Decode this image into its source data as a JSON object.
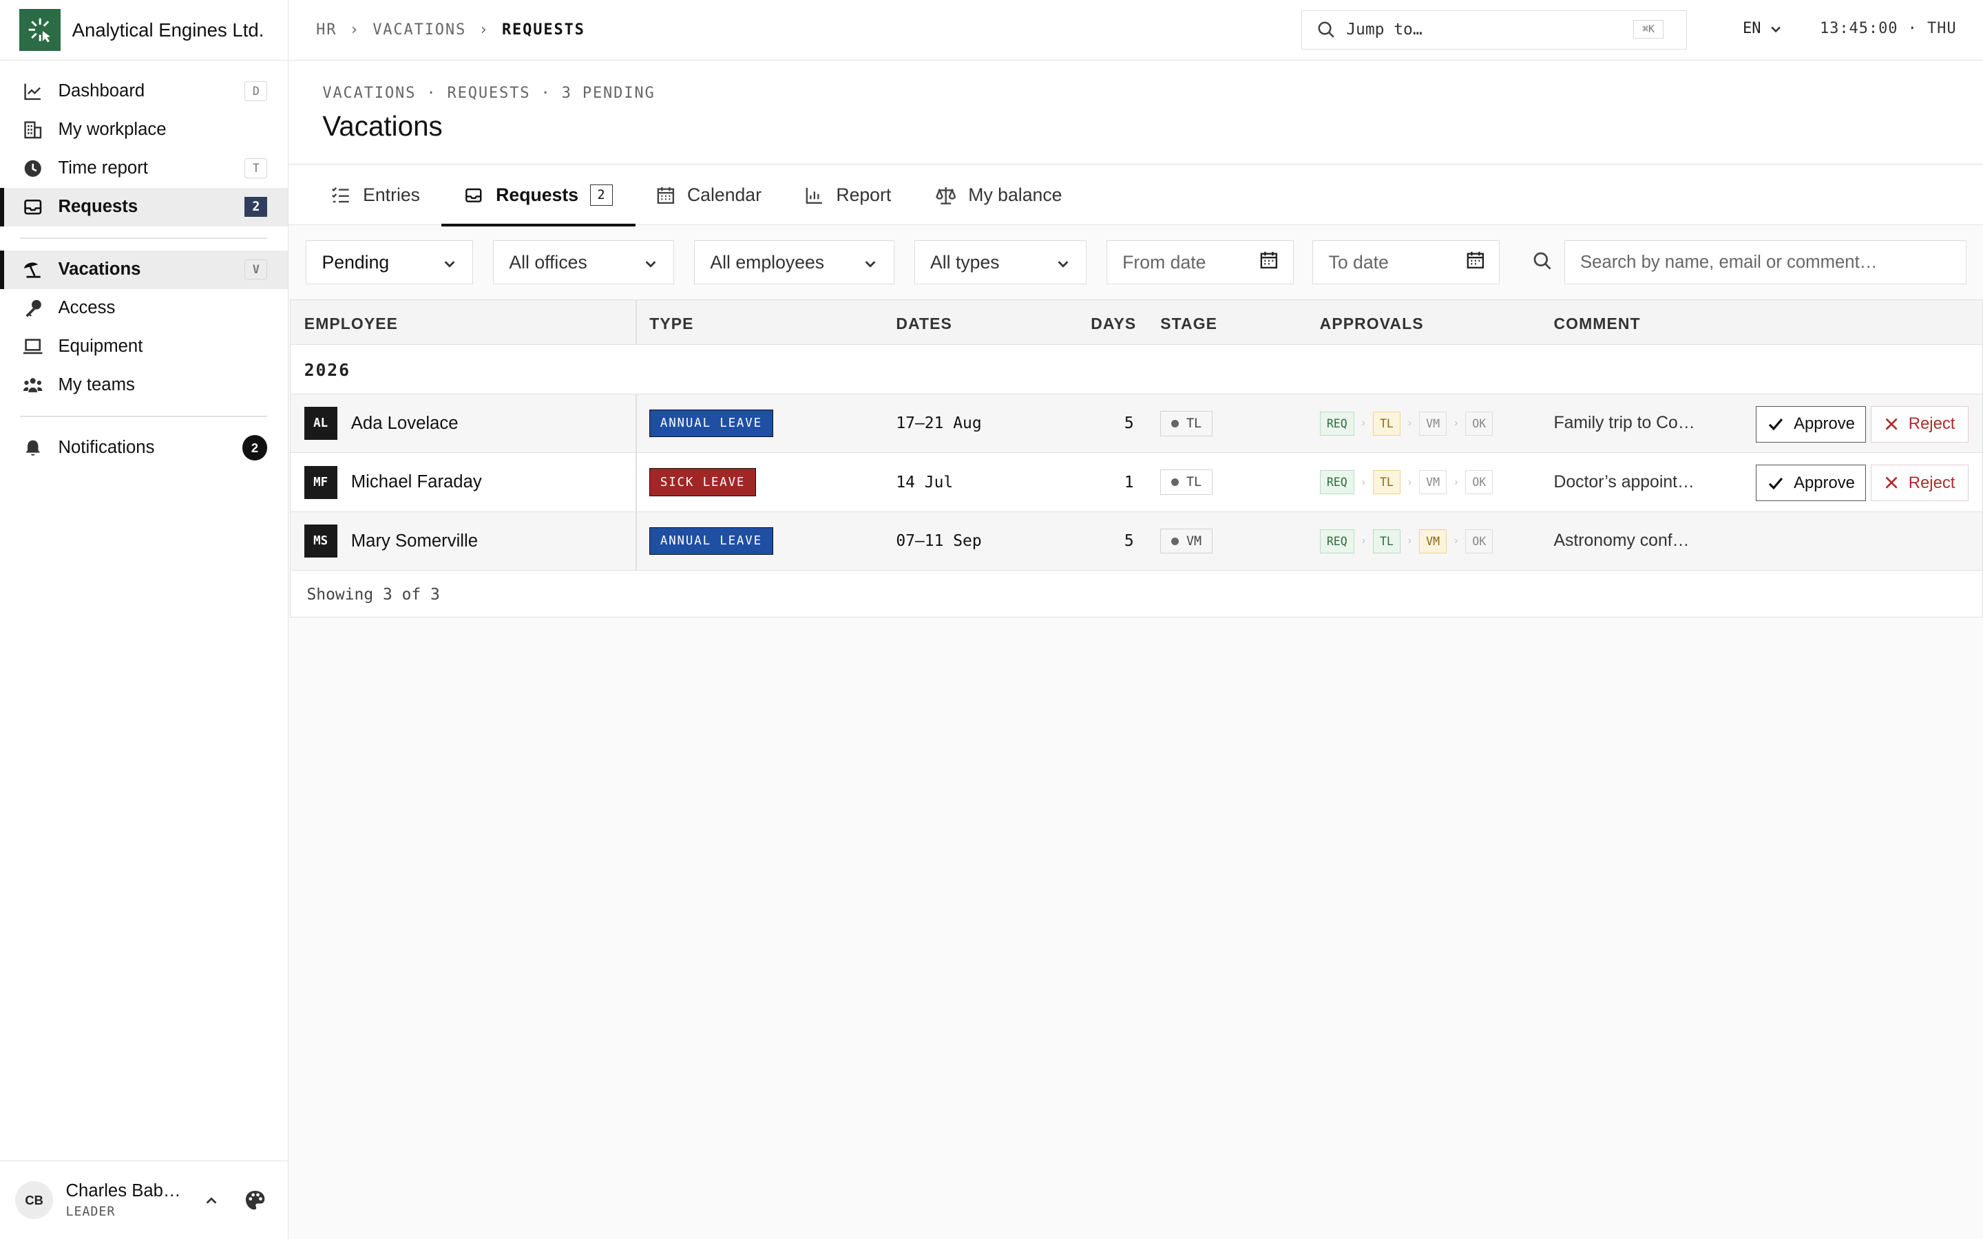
{
  "app": {
    "name": "Analytical Engines Ltd."
  },
  "sidebar": {
    "items": [
      {
        "label": "Dashboard",
        "icon": "chart-line-icon",
        "key": "D"
      },
      {
        "label": "My workplace",
        "icon": "building-icon"
      },
      {
        "label": "Time report",
        "icon": "clock-icon",
        "key": "T"
      },
      {
        "label": "Requests",
        "icon": "inbox-icon",
        "count": "2",
        "active": true
      },
      {
        "label": "Vacations",
        "icon": "beach-umbrella-icon",
        "key": "V",
        "active": true
      },
      {
        "label": "Access",
        "icon": "key-icon"
      },
      {
        "label": "Equipment",
        "icon": "laptop-icon"
      },
      {
        "label": "My teams",
        "icon": "users-icon"
      },
      {
        "label": "Notifications",
        "icon": "bell-icon",
        "count": "2"
      }
    ],
    "user": {
      "initials": "CB",
      "name": "Charles Bab…",
      "role": "LEADER"
    }
  },
  "topbar": {
    "breadcrumb": [
      "HR",
      "VACATIONS",
      "REQUESTS"
    ],
    "jump_placeholder": "Jump to…",
    "jump_shortcut": "⌘K",
    "language": "EN",
    "clock": "13:45:00 · THU"
  },
  "header": {
    "subtitle": "VACATIONS · REQUESTS · 3 PENDING",
    "title": "Vacations"
  },
  "tabs": [
    {
      "label": "Entries",
      "icon": "list-icon"
    },
    {
      "label": "Requests",
      "icon": "inbox-icon",
      "count": "2",
      "active": true
    },
    {
      "label": "Calendar",
      "icon": "calendar-icon"
    },
    {
      "label": "Report",
      "icon": "bar-chart-icon"
    },
    {
      "label": "My balance",
      "icon": "scale-icon"
    }
  ],
  "filters": {
    "status": "Pending",
    "office": "All offices",
    "employee": "All employees",
    "type": "All types",
    "from_date": "From date",
    "to_date": "To date",
    "search_placeholder": "Search by name, email or comment…"
  },
  "table": {
    "columns": [
      "EMPLOYEE",
      "TYPE",
      "DATES",
      "DAYS",
      "STAGE",
      "APPROVALS",
      "COMMENT"
    ],
    "group": "2026",
    "approval_steps": [
      "REQ",
      "TL",
      "VM",
      "OK"
    ],
    "rows": [
      {
        "initials": "AL",
        "name": "Ada Lovelace",
        "type": "ANNUAL LEAVE",
        "type_color": "#1e4fa3",
        "dates": "17–21 Aug",
        "days": "5",
        "stage": "TL",
        "done": 1,
        "current": 1,
        "comment": "Family trip to Co…",
        "actions": true
      },
      {
        "initials": "MF",
        "name": "Michael Faraday",
        "type": "SICK LEAVE",
        "type_color": "#a12626",
        "dates": "14 Jul",
        "days": "1",
        "stage": "TL",
        "done": 1,
        "current": 1,
        "comment": "Doctor’s appoint…",
        "actions": true
      },
      {
        "initials": "MS",
        "name": "Mary Somerville",
        "type": "ANNUAL LEAVE",
        "type_color": "#1e4fa3",
        "dates": "07–11 Sep",
        "days": "5",
        "stage": "VM",
        "done": 2,
        "current": 2,
        "comment": "Astronomy conf…",
        "actions": false
      }
    ],
    "approve_label": "Approve",
    "reject_label": "Reject",
    "footer": "Showing 3 of 3"
  }
}
